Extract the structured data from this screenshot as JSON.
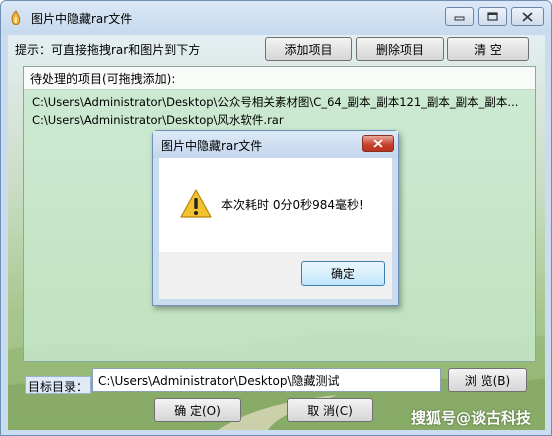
{
  "window": {
    "title": "图片中隐藏rar文件"
  },
  "toolbar": {
    "hint": "提示：可直接拖拽rar和图片到下方",
    "add_label": "添加项目",
    "delete_label": "删除项目",
    "clear_label": "清 空"
  },
  "list": {
    "header": "待处理的项目(可拖拽添加):",
    "items": [
      "C:\\Users\\Administrator\\Desktop\\公众号相关素材图\\C_64_副本_副本121_副本_副本_副本...",
      "C:\\Users\\Administrator\\Desktop\\风水软件.rar"
    ]
  },
  "target": {
    "label": "目标目录：",
    "value": "C:\\Users\\Administrator\\Desktop\\隐藏测试",
    "browse_label": "浏 览(B)"
  },
  "footer": {
    "ok_label": "确 定(O)",
    "cancel_label": "取 消(C)"
  },
  "dialog": {
    "title": "图片中隐藏rar文件",
    "message": "本次耗时 0分0秒984毫秒!",
    "ok_label": "确定"
  },
  "watermark": "搜狐号@谈古科技",
  "colors": {
    "window_frame": "#c9dcf0",
    "list_background": "#c8e9cd",
    "dialog_close": "#c7452e",
    "warning": "#f2c230"
  }
}
